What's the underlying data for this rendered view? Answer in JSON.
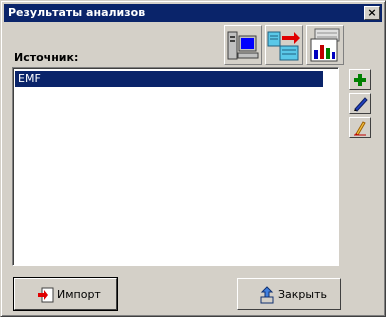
{
  "window": {
    "title": "Результаты анализов",
    "close_glyph": "×"
  },
  "toolbar": {
    "icons": [
      "computer-icon",
      "transfer-icon",
      "report-icon"
    ]
  },
  "source": {
    "label": "Источник:",
    "items": [
      "EMF"
    ],
    "selected_index": 0
  },
  "side_buttons": {
    "icons": [
      "add-icon",
      "edit-icon",
      "delete-icon"
    ]
  },
  "buttons": {
    "import_label": "Импорт",
    "close_label": "Закрыть"
  },
  "colors": {
    "title_bar": "#0a246a",
    "selection": "#0a246a",
    "face": "#d4d0c8"
  }
}
